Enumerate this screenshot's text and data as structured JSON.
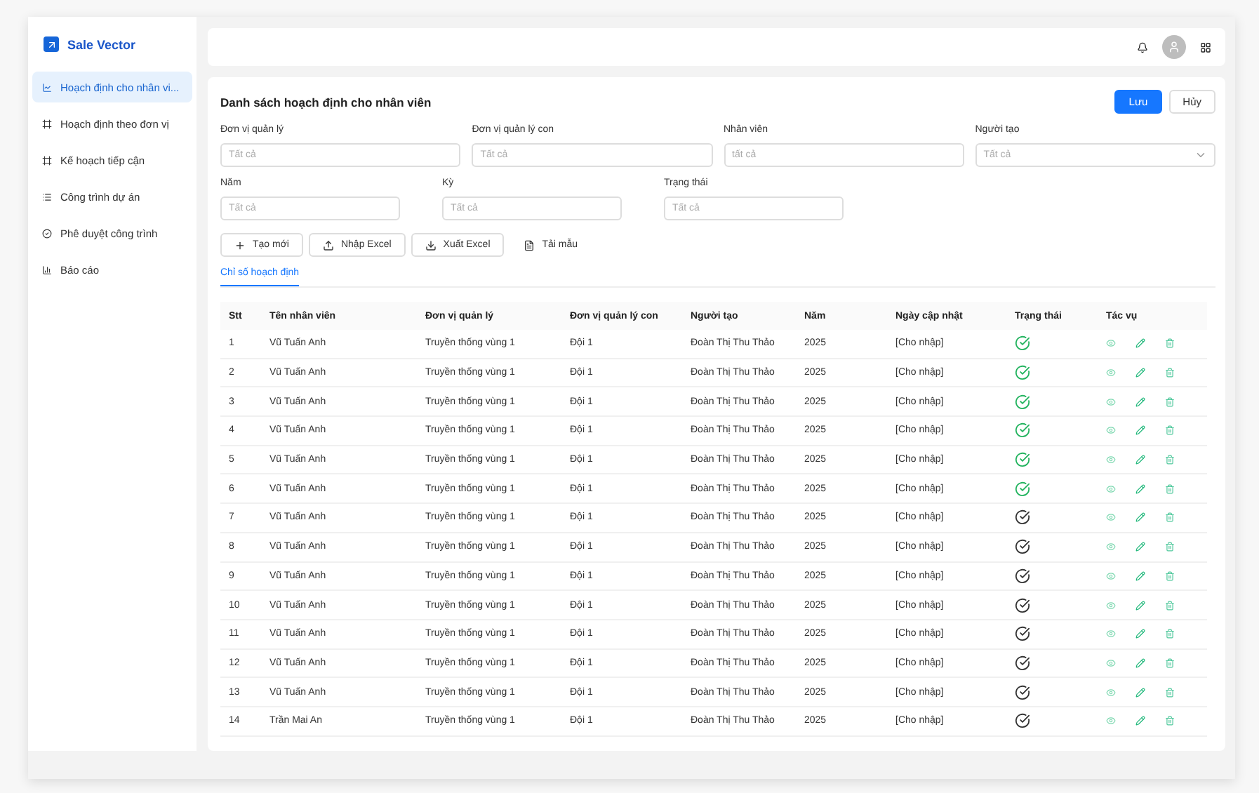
{
  "app": {
    "name": "Sale Vector"
  },
  "sidebar": {
    "items": [
      {
        "label": "Hoạch định cho nhân vi...",
        "selected": true
      },
      {
        "label": "Hoạch định theo đơn vị",
        "selected": false
      },
      {
        "label": "Kế hoạch tiếp cận",
        "selected": false
      },
      {
        "label": "Công trình dự án",
        "selected": false
      },
      {
        "label": "Phê duyệt công trình",
        "selected": false
      },
      {
        "label": "Báo cáo",
        "selected": false
      }
    ]
  },
  "page": {
    "title": "Danh sách hoạch định cho nhân viên",
    "save": "Lưu",
    "cancel": "Hủy"
  },
  "filters_row_1": [
    {
      "label": "Đơn vị quản lý",
      "placeholder": "Tất cả",
      "kind": "text"
    },
    {
      "label": "Đơn vị quản lý con",
      "placeholder": "Tất cả",
      "kind": "text"
    },
    {
      "label": "Nhân viên",
      "placeholder": "tất cả",
      "kind": "text"
    },
    {
      "label": "Người tạo",
      "placeholder": "Tất cả",
      "kind": "select"
    }
  ],
  "filters_row_2": [
    {
      "label": "Năm",
      "placeholder": "Tất cả"
    },
    {
      "label": "Kỳ",
      "placeholder": "Tất cả"
    },
    {
      "label": "Trạng thái",
      "placeholder": "Tất cả"
    }
  ],
  "actions": [
    {
      "label": "Tạo mới",
      "kind": "outlined"
    },
    {
      "label": "Nhập Excel",
      "kind": "outlined"
    },
    {
      "label": "Xuất Excel",
      "kind": "outlined"
    },
    {
      "label": "Tải mẫu",
      "kind": "plain"
    }
  ],
  "tabs": [
    {
      "label": "Chỉ số hoạch định",
      "selected": true
    }
  ],
  "table": {
    "columns": [
      "Stt",
      "Tên nhân viên",
      "Đơn vị quản lý",
      "Đơn vị quản lý con",
      "Người tạo",
      "Năm",
      "Ngày cập nhật",
      "Trạng thái",
      "Tác vụ"
    ],
    "rows": [
      {
        "cells": [
          "1",
          "Vũ Tuấn Anh",
          "Truyền thống vùng 1",
          "Đội 1",
          "Đoàn Thị Thu Thảo",
          "2025",
          "[Cho nhập]"
        ],
        "approved": true
      },
      {
        "cells": [
          "2",
          "Vũ Tuấn Anh",
          "Truyền thống vùng 1",
          "Đội 1",
          "Đoàn Thị Thu Thảo",
          "2025",
          "[Cho nhập]"
        ],
        "approved": true
      },
      {
        "cells": [
          "3",
          "Vũ Tuấn Anh",
          "Truyền thống vùng 1",
          "Đội 1",
          "Đoàn Thị Thu Thảo",
          "2025",
          "[Cho nhập]"
        ],
        "approved": true
      },
      {
        "cells": [
          "4",
          "Vũ Tuấn Anh",
          "Truyền thống vùng 1",
          "Đội 1",
          "Đoàn Thị Thu Thảo",
          "2025",
          "[Cho nhập]"
        ],
        "approved": true
      },
      {
        "cells": [
          "5",
          "Vũ Tuấn Anh",
          "Truyền thống vùng 1",
          "Đội 1",
          "Đoàn Thị Thu Thảo",
          "2025",
          "[Cho nhập]"
        ],
        "approved": true
      },
      {
        "cells": [
          "6",
          "Vũ Tuấn Anh",
          "Truyền thống vùng 1",
          "Đội 1",
          "Đoàn Thị Thu Thảo",
          "2025",
          "[Cho nhập]"
        ],
        "approved": true
      },
      {
        "cells": [
          "7",
          "Vũ Tuấn Anh",
          "Truyền thống vùng 1",
          "Đội 1",
          "Đoàn Thị Thu Thảo",
          "2025",
          "[Cho nhập]"
        ],
        "approved": false
      },
      {
        "cells": [
          "8",
          "Vũ Tuấn Anh",
          "Truyền thống vùng 1",
          "Đội 1",
          "Đoàn Thị Thu Thảo",
          "2025",
          "[Cho nhập]"
        ],
        "approved": false
      },
      {
        "cells": [
          "9",
          "Vũ Tuấn Anh",
          "Truyền thống vùng 1",
          "Đội 1",
          "Đoàn Thị Thu Thảo",
          "2025",
          "[Cho nhập]"
        ],
        "approved": false
      },
      {
        "cells": [
          "10",
          "Vũ Tuấn Anh",
          "Truyền thống vùng 1",
          "Đội 1",
          "Đoàn Thị Thu Thảo",
          "2025",
          "[Cho nhập]"
        ],
        "approved": false
      },
      {
        "cells": [
          "11",
          "Vũ Tuấn Anh",
          "Truyền thống vùng 1",
          "Đội 1",
          "Đoàn Thị Thu Thảo",
          "2025",
          "[Cho nhập]"
        ],
        "approved": false
      },
      {
        "cells": [
          "12",
          "Vũ Tuấn Anh",
          "Truyền thống vùng 1",
          "Đội 1",
          "Đoàn Thị Thu Thảo",
          "2025",
          "[Cho nhập]"
        ],
        "approved": false
      },
      {
        "cells": [
          "13",
          "Vũ Tuấn Anh",
          "Truyền thống vùng 1",
          "Đội 1",
          "Đoàn Thị Thu Thảo",
          "2025",
          "[Cho nhập]"
        ],
        "approved": false
      },
      {
        "cells": [
          "14",
          "Trần Mai An",
          "Truyền thống vùng 1",
          "Đội 1",
          "Đoàn Thị Thu Thảo",
          "2025",
          "[Cho nhập]"
        ],
        "approved": false
      }
    ]
  }
}
